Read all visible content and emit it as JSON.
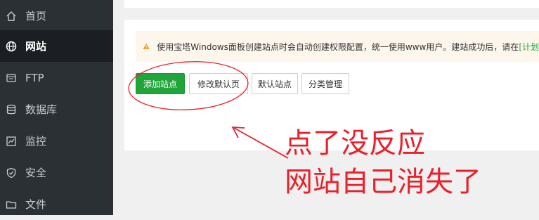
{
  "sidebar": {
    "items": [
      {
        "label": "首页",
        "icon": "home-icon"
      },
      {
        "label": "网站",
        "icon": "globe-icon",
        "active": true
      },
      {
        "label": "FTP",
        "icon": "ftp-icon"
      },
      {
        "label": "数据库",
        "icon": "database-icon"
      },
      {
        "label": "监控",
        "icon": "monitor-icon"
      },
      {
        "label": "安全",
        "icon": "shield-icon"
      },
      {
        "label": "文件",
        "icon": "folder-icon"
      }
    ]
  },
  "notice": {
    "text": "使用宝塔Windows面板创建站点时会自动创建权限配置，统一使用www用户。建站成功后，请在",
    "link_text": "[计划"
  },
  "toolbar": {
    "add_site_label": "添加站点",
    "modify_default_page_label": "修改默认页",
    "default_site_label": "默认站点",
    "category_manage_label": "分类管理"
  },
  "annotation": {
    "line1": "点了没反应",
    "line2": "网站自己消失了"
  },
  "colors": {
    "sidebar_bg": "#2b3035",
    "primary": "#20a53a",
    "annotation_red": "#e8212b",
    "warning": "#f39c12"
  }
}
